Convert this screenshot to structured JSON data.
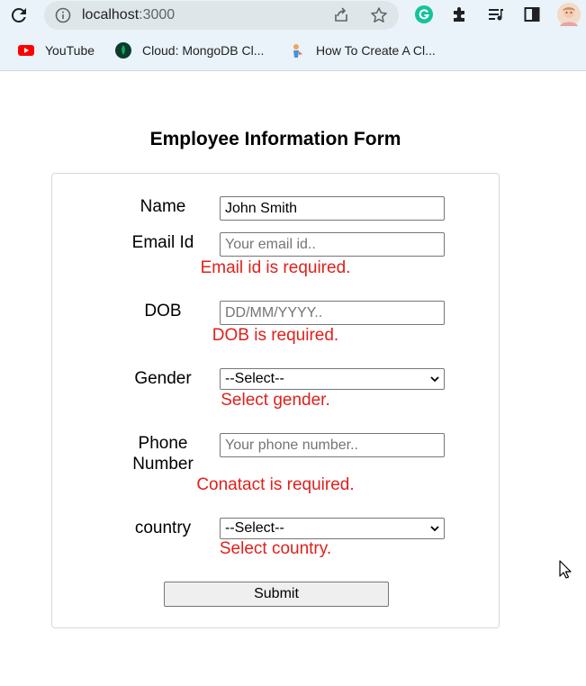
{
  "browser": {
    "url_host": "localhost",
    "url_port": ":3000",
    "bookmarks": [
      {
        "label": "YouTube",
        "icon": "youtube-icon"
      },
      {
        "label": "Cloud: MongoDB Cl...",
        "icon": "mongodb-leaf-icon"
      },
      {
        "label": "How To Create A Cl...",
        "icon": "page-favicon"
      }
    ]
  },
  "form": {
    "title": "Employee Information Form",
    "name": {
      "label": "Name",
      "value": "John Smith"
    },
    "email": {
      "label": "Email Id",
      "placeholder": "Your email id..",
      "error": "Email id is required."
    },
    "dob": {
      "label": "DOB",
      "placeholder": "DD/MM/YYYY..",
      "error": "DOB is required."
    },
    "gender": {
      "label": "Gender",
      "selected": "--Select--",
      "error": "Select gender."
    },
    "phone": {
      "label_line1": "Phone",
      "label_line2": "Number",
      "placeholder": "Your phone number..",
      "error": "Conatact is required."
    },
    "country": {
      "label": "country",
      "selected": "--Select--",
      "error": "Select country."
    },
    "submit_label": "Submit"
  },
  "colors": {
    "error": "#e0201b",
    "chrome_bg": "#e9f3f9",
    "grammarly": "#15c39a",
    "youtube": "#ff0000",
    "mongodb": "#13aa52"
  }
}
